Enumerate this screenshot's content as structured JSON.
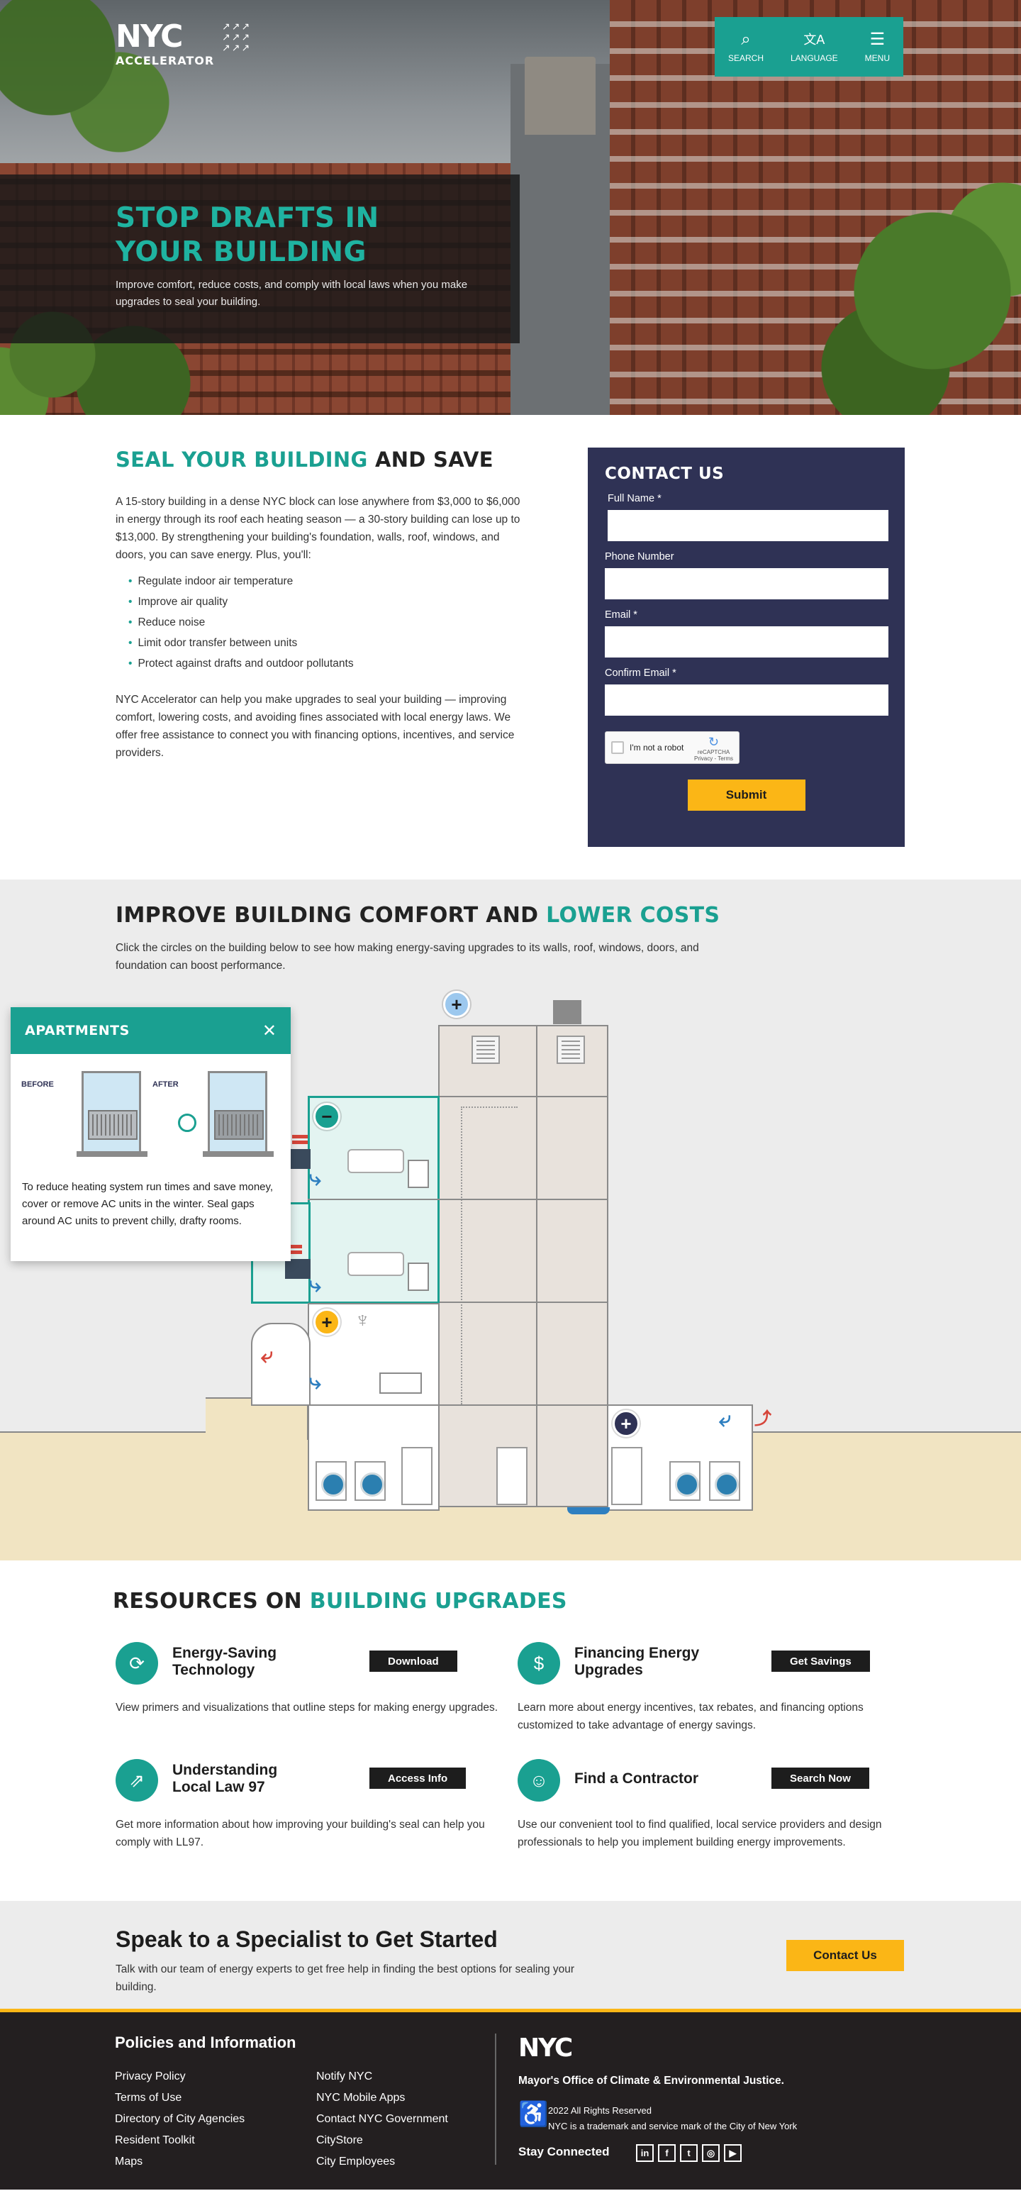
{
  "header": {
    "logo_top": "NYC",
    "logo_bottom": "ACCELERATOR",
    "nav": [
      {
        "label": "SEARCH",
        "icon": "search-icon",
        "glyph": "⌕"
      },
      {
        "label": "LANGUAGE",
        "icon": "translate-icon",
        "glyph": "文A"
      },
      {
        "label": "MENU",
        "icon": "menu-icon",
        "glyph": "☰"
      }
    ]
  },
  "hero": {
    "title_line1": "STOP DRAFTS IN",
    "title_line2": "YOUR BUILDING",
    "subtitle": "Improve comfort, reduce costs, and comply with local laws when you make upgrades to seal your building."
  },
  "seal": {
    "title_accent": "SEAL YOUR BUILDING",
    "title_rest": " AND SAVE",
    "paragraph1": "A 15-story building in a dense NYC block can lose anywhere from $3,000 to $6,000 in energy through its roof each heating season — a 30-story building can lose up to $13,000. By strengthening your building's foundation, walls, roof, windows, and doors, you can save energy. Plus, you'll:",
    "bullets": [
      "Regulate indoor air temperature",
      "Improve air quality",
      "Reduce noise",
      "Limit odor transfer between units",
      "Protect against drafts and outdoor pollutants"
    ],
    "paragraph2": "NYC Accelerator can help you make upgrades to seal your building — improving comfort, lowering costs, and avoiding fines associated with local energy laws. We offer free assistance to connect you with financing options, incentives, and service providers."
  },
  "contact_form": {
    "title": "CONTACT US",
    "fields": [
      "Full Name *",
      "Phone Number",
      "Email *",
      "Confirm Email *"
    ],
    "captcha_label": "I'm not a robot",
    "captcha_brand": "reCAPTCHA",
    "captcha_links": "Privacy - Terms",
    "submit": "Submit"
  },
  "improve": {
    "title_rest": "IMPROVE BUILDING COMFORT AND ",
    "title_accent": "LOWER COSTS",
    "intro": "Click the circles on the building below to see how making energy-saving upgrades to its walls, roof, windows, doors, and foundation can boost performance.",
    "popup": {
      "title": "APARTMENTS",
      "before": "BEFORE",
      "after": "AFTER",
      "text": "To reduce heating system run times and save money, cover or remove AC units in the winter. Seal gaps around AC units to prevent chilly, drafty rooms."
    },
    "hotspot_colors": {
      "roof": "#9cc8ee",
      "apartments": "#1aa091",
      "lobby": "#fbb616",
      "basement": "#2f3255"
    }
  },
  "resources": {
    "title_rest": "RESOURCES ON ",
    "title_accent": "BUILDING UPGRADES",
    "items": [
      {
        "title": "Energy-Saving Technology",
        "button": "Download",
        "desc": "View primers and visualizations that outline steps for making energy upgrades.",
        "icon": "energy-tech-icon",
        "glyph": "⟳"
      },
      {
        "title": "Financing Energy Upgrades",
        "button": "Get Savings",
        "desc": "Learn more about energy incentives, tax rebates, and financing options customized to take advantage of energy savings.",
        "icon": "financing-icon",
        "glyph": "$"
      },
      {
        "title": "Understanding Local Law 97",
        "button": "Access Info",
        "desc": "Get more information about how improving your building's seal can help you comply with LL97.",
        "icon": "local-law-icon",
        "glyph": "⇗"
      },
      {
        "title": "Find a Contractor",
        "button": "Search Now",
        "desc": "Use our convenient tool to find qualified, local service providers and design professionals to help you implement building energy improvements.",
        "icon": "contractor-icon",
        "glyph": "☺"
      }
    ]
  },
  "speak": {
    "title": "Speak to a Specialist to Get Started",
    "text": "Talk with our team of energy experts to get free help in finding the best options for sealing your building.",
    "button": "Contact Us"
  },
  "footer": {
    "heading": "Policies and Information",
    "col1": [
      "Privacy Policy",
      "Terms of Use",
      "Directory of City Agencies",
      "Resident Toolkit",
      "Maps"
    ],
    "col2": [
      "Notify NYC",
      "NYC Mobile Apps",
      "Contact NYC Government",
      "CityStore",
      "City Employees"
    ],
    "logo": "NYC",
    "office": "Mayor's Office of Climate & Environmental Justice.",
    "copyright1": "2022 All Rights Reserved",
    "copyright2": "NYC is a trademark and service mark of the City of New York",
    "stay_connected": "Stay Connected",
    "social": [
      {
        "name": "linkedin-icon",
        "glyph": "in"
      },
      {
        "name": "facebook-icon",
        "glyph": "f"
      },
      {
        "name": "twitter-icon",
        "glyph": "t"
      },
      {
        "name": "instagram-icon",
        "glyph": "◎"
      },
      {
        "name": "youtube-icon",
        "glyph": "▶"
      }
    ]
  },
  "colors": {
    "teal": "#1aa091",
    "navy": "#2f3255",
    "yellow": "#fbb616",
    "dark": "#231f20"
  }
}
